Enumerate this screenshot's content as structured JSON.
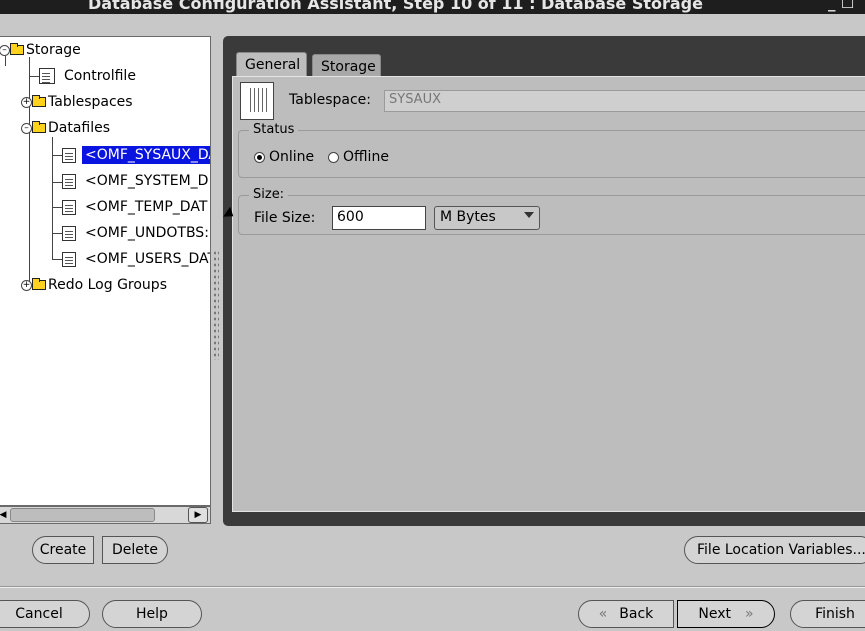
{
  "window": {
    "title": "Database Configuration Assistant, Step 10 of 11 : Database Storage",
    "controls": "_ ☐"
  },
  "tree": {
    "root": "Storage",
    "items": [
      {
        "label": "Controlfile"
      },
      {
        "label": "Tablespaces"
      },
      {
        "label": "Datafiles"
      },
      {
        "label": "<OMF_SYSAUX_DA"
      },
      {
        "label": "<OMF_SYSTEM_D."
      },
      {
        "label": "<OMF_TEMP_DAT"
      },
      {
        "label": "<OMF_UNDOTBS:"
      },
      {
        "label": "<OMF_USERS_DAT"
      },
      {
        "label": "Redo Log Groups"
      }
    ],
    "selected_index": 3
  },
  "tabs": [
    {
      "label": "General"
    },
    {
      "label": "Storage"
    }
  ],
  "general": {
    "tablespace_label": "Tablespace:",
    "tablespace_value": "SYSAUX",
    "status_legend": "Status",
    "online_label": "Online",
    "offline_label": "Offline",
    "online_selected": true,
    "size_legend": "Size:",
    "file_size_label": "File Size:",
    "file_size_value": "600",
    "unit_value": "M Bytes"
  },
  "buttons": {
    "create": "Create",
    "delete": "Delete",
    "file_location": "File Location Variables...",
    "cancel": "Cancel",
    "help": "Help",
    "back": "Back",
    "next": "Next",
    "finish": "Finish",
    "back_icon": "«",
    "next_icon": "»"
  },
  "colors": {
    "selection": "#0a14e0",
    "folder": "#ffd21e"
  }
}
